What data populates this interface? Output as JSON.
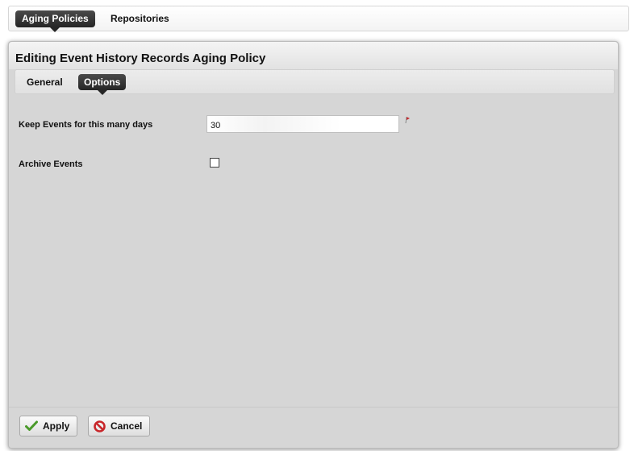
{
  "nav": {
    "tabs": [
      {
        "label": "Aging Policies",
        "active": true
      },
      {
        "label": "Repositories",
        "active": false
      }
    ]
  },
  "dialog": {
    "title": "Editing Event History Records Aging Policy",
    "tabs": [
      {
        "label": "General",
        "active": false
      },
      {
        "label": "Options",
        "active": true
      }
    ],
    "fields": {
      "keep_days": {
        "label": "Keep Events for this many days",
        "value": "30",
        "required": true
      },
      "archive": {
        "label": "Archive Events",
        "checked": false
      }
    },
    "buttons": {
      "apply": {
        "label": "Apply",
        "icon": "checkmark-icon",
        "icon_color": "#4a9a2a"
      },
      "cancel": {
        "label": "Cancel",
        "icon": "no-entry-icon",
        "icon_color": "#c8262a"
      }
    }
  },
  "colors": {
    "active_tab_bg": "#2b2b2b",
    "panel_bg": "#d6d6d6",
    "required_marker": "#c8262a"
  }
}
